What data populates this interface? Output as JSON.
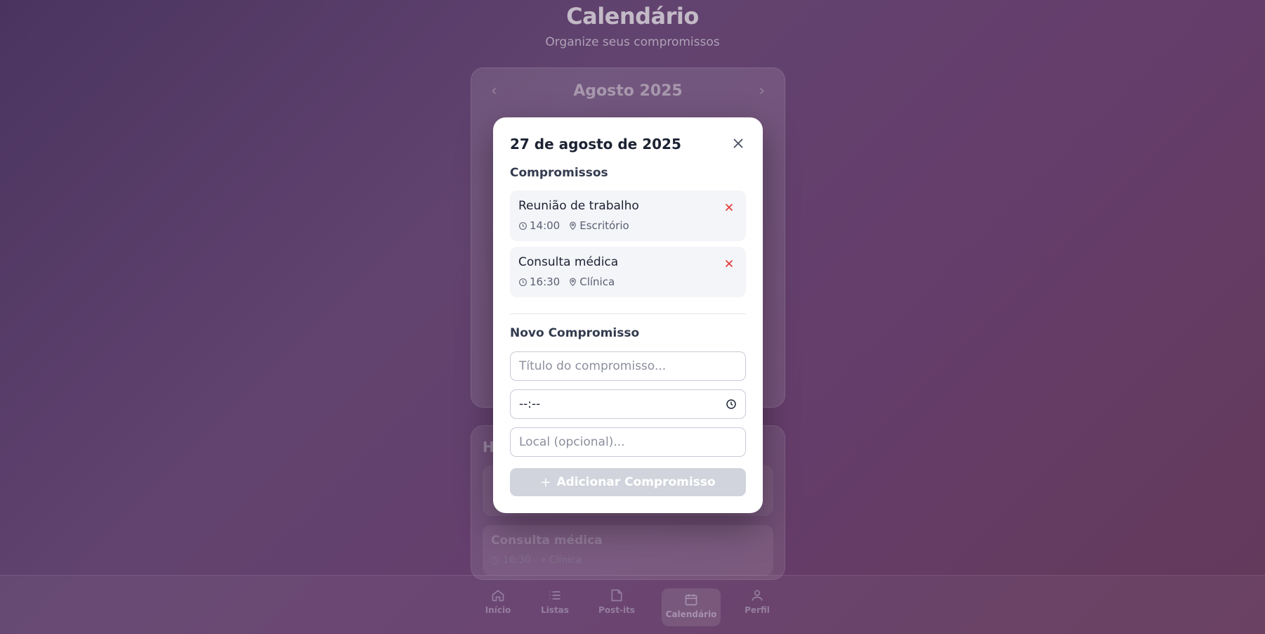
{
  "page": {
    "title": "Calendário",
    "subtitle": "Organize seus compromissos"
  },
  "calendar": {
    "month": "Agosto 2025",
    "prev_icon": "chevron-left-icon",
    "next_icon": "chevron-right-icon"
  },
  "today_list": {
    "title_partial": "H",
    "items": [
      {
        "title": "",
        "time": "",
        "location": ""
      },
      {
        "title": "Consulta médica",
        "time": "16:30",
        "location": "Clínica"
      }
    ]
  },
  "nav": {
    "items": [
      {
        "label": "Início",
        "icon": "home-icon",
        "active": false
      },
      {
        "label": "Listas",
        "icon": "list-icon",
        "active": false
      },
      {
        "label": "Post-its",
        "icon": "note-icon",
        "active": false
      },
      {
        "label": "Calendário",
        "icon": "calendar-icon",
        "active": true
      },
      {
        "label": "Perfil",
        "icon": "user-icon",
        "active": false
      }
    ]
  },
  "modal": {
    "date_title": "27 de agosto de 2025",
    "appointments_label": "Compromissos",
    "appointments": [
      {
        "title": "Reunião de trabalho",
        "time": "14:00",
        "location": "Escritório"
      },
      {
        "title": "Consulta médica",
        "time": "16:30",
        "location": "Clínica"
      }
    ],
    "new_label": "Novo Compromisso",
    "title_placeholder": "Título do compromisso...",
    "time_value": "--:--",
    "local_placeholder": "Local (opcional)...",
    "add_button_label": "Adicionar Compromisso",
    "colors": {
      "delete": "#e53935",
      "button_disabled": "#d1d4dc"
    }
  }
}
